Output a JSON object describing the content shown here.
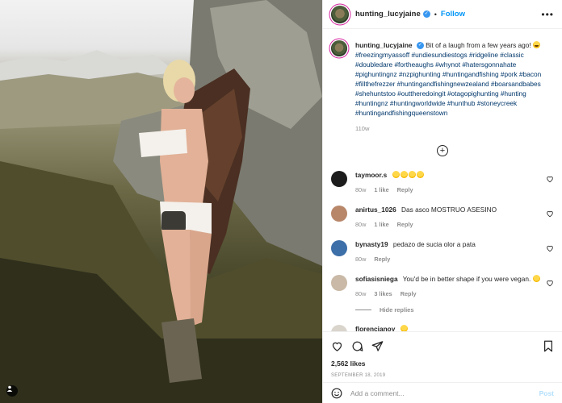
{
  "header": {
    "username": "hunting_lucyjaine",
    "follow_label": "Follow",
    "more_label": "•••"
  },
  "caption": {
    "username": "hunting_lucyjaine",
    "text": "Bit of a laugh from a few years ago!",
    "hashtags": "#freezingmyassoff #undiesundiestogs #ridgeline #classic #doubledare #fortheaughs #whynot #hatersgonnahate #pighuntingnz #nzpighunting #huntingandfishing #pork #bacon #fillthefrezzer #huntingandfishingnewzealand #boarsandbabes #shehuntstoo #outtheredoingit #otagopighunting #hunting #huntingnz #huntingworldwide #hunthub #stoneycreek #huntingandfishingqueenstown",
    "age": "110w"
  },
  "comments": [
    {
      "username": "taymoor.s",
      "text": "",
      "emoji_count": 4,
      "age": "80w",
      "likes": "1 like",
      "reply": "Reply",
      "avatar_color": "#1c1c1c"
    },
    {
      "username": "anirtus_1026",
      "text": "Das asco MOSTRUO ASESINO",
      "age": "80w",
      "likes": "1 like",
      "reply": "Reply",
      "avatar_color": "#b8876a"
    },
    {
      "username": "bynasty19",
      "text": "pedazo de sucia olor a pata",
      "age": "80w",
      "likes": "",
      "reply": "Reply",
      "avatar_color": "#3d6fa8"
    },
    {
      "username": "sofiasisniega",
      "text": "You'd be in better shape if you were vegan.",
      "age": "80w",
      "likes": "3 likes",
      "reply": "Reply",
      "avatar_color": "#c9b9a6"
    },
    {
      "username": "florencianoy",
      "text": "",
      "age": "",
      "likes": "",
      "reply": "",
      "avatar_color": "#d9d4cc"
    }
  ],
  "hide_replies_label": "Hide replies",
  "likes_count": "2,562 likes",
  "post_date": "SEPTEMBER 18, 2019",
  "add_comment": {
    "placeholder": "Add a comment...",
    "post_label": "Post"
  },
  "colors": {
    "link_blue": "#0095f6",
    "hashtag": "#00376b",
    "muted": "#8e8e8e",
    "verified": "#3897f0"
  }
}
